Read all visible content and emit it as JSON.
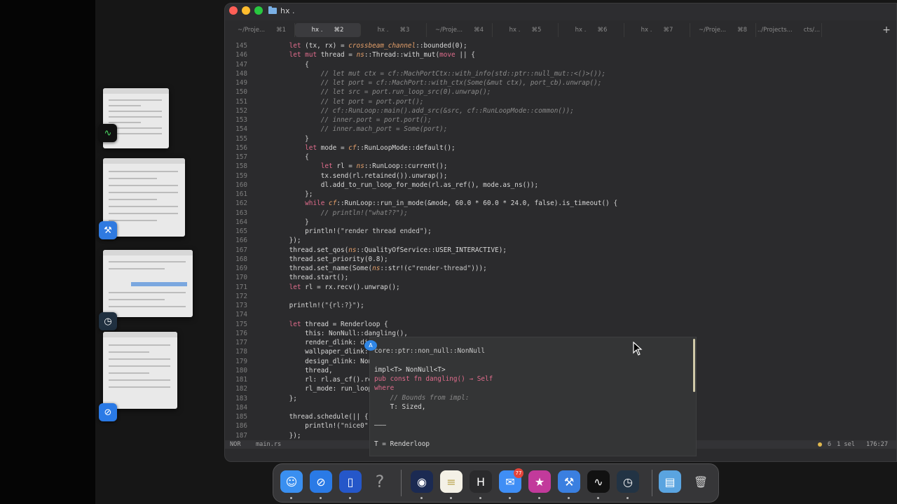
{
  "window": {
    "title": "hx .",
    "traffic_lights": [
      "#fe5f57",
      "#febc2e",
      "#28c840"
    ]
  },
  "tabs": [
    {
      "label": "~/Proje...",
      "shortcut": "⌘1",
      "active": false
    },
    {
      "label": "hx .",
      "shortcut": "⌘2",
      "active": true
    },
    {
      "label": "hx .",
      "shortcut": "⌘3",
      "active": false
    },
    {
      "label": "~/Proje...",
      "shortcut": "⌘4",
      "active": false
    },
    {
      "label": "hx .",
      "shortcut": "⌘5",
      "active": false
    },
    {
      "label": "hx .",
      "shortcut": "⌘6",
      "active": false
    },
    {
      "label": "hx .",
      "shortcut": "⌘7",
      "active": false
    },
    {
      "label": "~/Proje...",
      "shortcut": "⌘8",
      "active": false
    },
    {
      "label": "../Projects...",
      "shortcut": "cts/...",
      "active": false
    }
  ],
  "tab_plus": "+",
  "code_lines": [
    {
      "n": "145",
      "t": "    let (tx, rx) = crossbeam_channel::bounded(0);"
    },
    {
      "n": "146",
      "t": "    let mut thread = ns::Thread::with_mut(move || {"
    },
    {
      "n": "147",
      "t": "        {"
    },
    {
      "n": "148",
      "t": "            // let mut ctx = cf::MachPortCtx::with_info(std::ptr::null_mut::<()>());"
    },
    {
      "n": "149",
      "t": "            // let port = cf::MachPort::with_ctx(Some(&mut ctx), port_cb).unwrap();"
    },
    {
      "n": "150",
      "t": "            // let src = port.run_loop_src(0).unwrap();"
    },
    {
      "n": "151",
      "t": "            // let port = port.port();"
    },
    {
      "n": "152",
      "t": "            // cf::RunLoop::main().add_src(&src, cf::RunLoopMode::common());"
    },
    {
      "n": "153",
      "t": "            // inner.port = port.port();"
    },
    {
      "n": "154",
      "t": "            // inner.mach_port = Some(port);"
    },
    {
      "n": "155",
      "t": "        }"
    },
    {
      "n": "156",
      "t": "        let mode = cf::RunLoopMode::default();"
    },
    {
      "n": "157",
      "t": "        {"
    },
    {
      "n": "158",
      "t": "            let rl = ns::RunLoop::current();"
    },
    {
      "n": "159",
      "t": "            tx.send(rl.retained()).unwrap();"
    },
    {
      "n": "160",
      "t": "            dl.add_to_run_loop_for_mode(rl.as_ref(), mode.as_ns());"
    },
    {
      "n": "161",
      "t": "        };"
    },
    {
      "n": "162",
      "t": "        while cf::RunLoop::run_in_mode(&mode, 60.0 * 60.0 * 24.0, false).is_timeout() {"
    },
    {
      "n": "163",
      "t": "            // println!(\"what??\");"
    },
    {
      "n": "164",
      "t": "        }"
    },
    {
      "n": "165",
      "t": "        println!(\"render thread ended\");"
    },
    {
      "n": "166",
      "t": "    });"
    },
    {
      "n": "167",
      "t": "    thread.set_qos(ns::QualityOfService::USER_INTERACTIVE);"
    },
    {
      "n": "168",
      "t": "    thread.set_priority(0.8);"
    },
    {
      "n": "169",
      "t": "    thread.set_name(Some(ns::str!(c\"render-thread\")));"
    },
    {
      "n": "170",
      "t": "    thread.start();"
    },
    {
      "n": "171",
      "t": "    let rl = rx.recv().unwrap();"
    },
    {
      "n": "172",
      "t": ""
    },
    {
      "n": "173",
      "t": "    println!(\"{rl:?}\");"
    },
    {
      "n": "174",
      "t": ""
    },
    {
      "n": "175",
      "t": "    let thread = Renderloop {"
    },
    {
      "n": "176",
      "t": "        this: NonNull::dangling(),"
    },
    {
      "n": "177",
      "t": "        render_dlink: dis"
    },
    {
      "n": "178",
      "t": "        wallpaper_dlink: S"
    },
    {
      "n": "179",
      "t": "        design_dlink: None"
    },
    {
      "n": "180",
      "t": "        thread,"
    },
    {
      "n": "181",
      "t": "        rl: rl.as_cf().ret"
    },
    {
      "n": "182",
      "t": "        rl_mode: run_loop_"
    },
    {
      "n": "183",
      "t": "    };"
    },
    {
      "n": "184",
      "t": ""
    },
    {
      "n": "185",
      "t": "    thread.schedule(|| {"
    },
    {
      "n": "186",
      "t": "        println!(\"nice0\");"
    },
    {
      "n": "187",
      "t": "    });"
    }
  ],
  "statusline": {
    "mode": "NOR",
    "file": "main.rs",
    "diagnostics": "6",
    "selection": "1 sel",
    "position": "176:27"
  },
  "hover_popup": {
    "badge": "A",
    "lines": [
      "core::ptr::non_null::NonNull",
      "",
      "impl<T> NonNull<T>",
      "pub const fn dangling() → Self",
      "where",
      "    // Bounds from impl:",
      "    T: Sized,",
      "",
      "———",
      "",
      "T = Renderloop"
    ]
  },
  "dock": {
    "apps": [
      {
        "name": "finder-icon",
        "color": "#3a8ff0",
        "glyph": "☺"
      },
      {
        "name": "safari-icon",
        "color": "#2a7ae6",
        "glyph": "⊘"
      },
      {
        "name": "app-icon",
        "color": "#2557c9",
        "glyph": "▯"
      },
      {
        "name": "help-icon",
        "color": "#4a4a4c",
        "glyph": "?"
      },
      {
        "name": "screen-app-icon",
        "color": "#1b2a52",
        "glyph": "◉"
      },
      {
        "name": "notes-icon",
        "color": "#f4f1e6",
        "glyph": "≡"
      },
      {
        "name": "helix-icon",
        "color": "#2a2a2c",
        "glyph": "H"
      },
      {
        "name": "mail-icon",
        "color": "#3f8ef5",
        "glyph": "✉"
      },
      {
        "name": "star-app-icon",
        "color": "#c23a9b",
        "glyph": "★"
      },
      {
        "name": "xcode-icon",
        "color": "#3a7fe0",
        "glyph": "⚒"
      },
      {
        "name": "activity-monitor-icon",
        "color": "#111111",
        "glyph": "∿"
      },
      {
        "name": "instruments-icon",
        "color": "#223344",
        "glyph": "◷"
      },
      {
        "name": "downloads-folder-icon",
        "color": "#5aa4e0",
        "glyph": "▤"
      },
      {
        "name": "trash-icon",
        "color": "#8a8a8c",
        "glyph": "🗑"
      }
    ],
    "mail_badge": "77"
  }
}
